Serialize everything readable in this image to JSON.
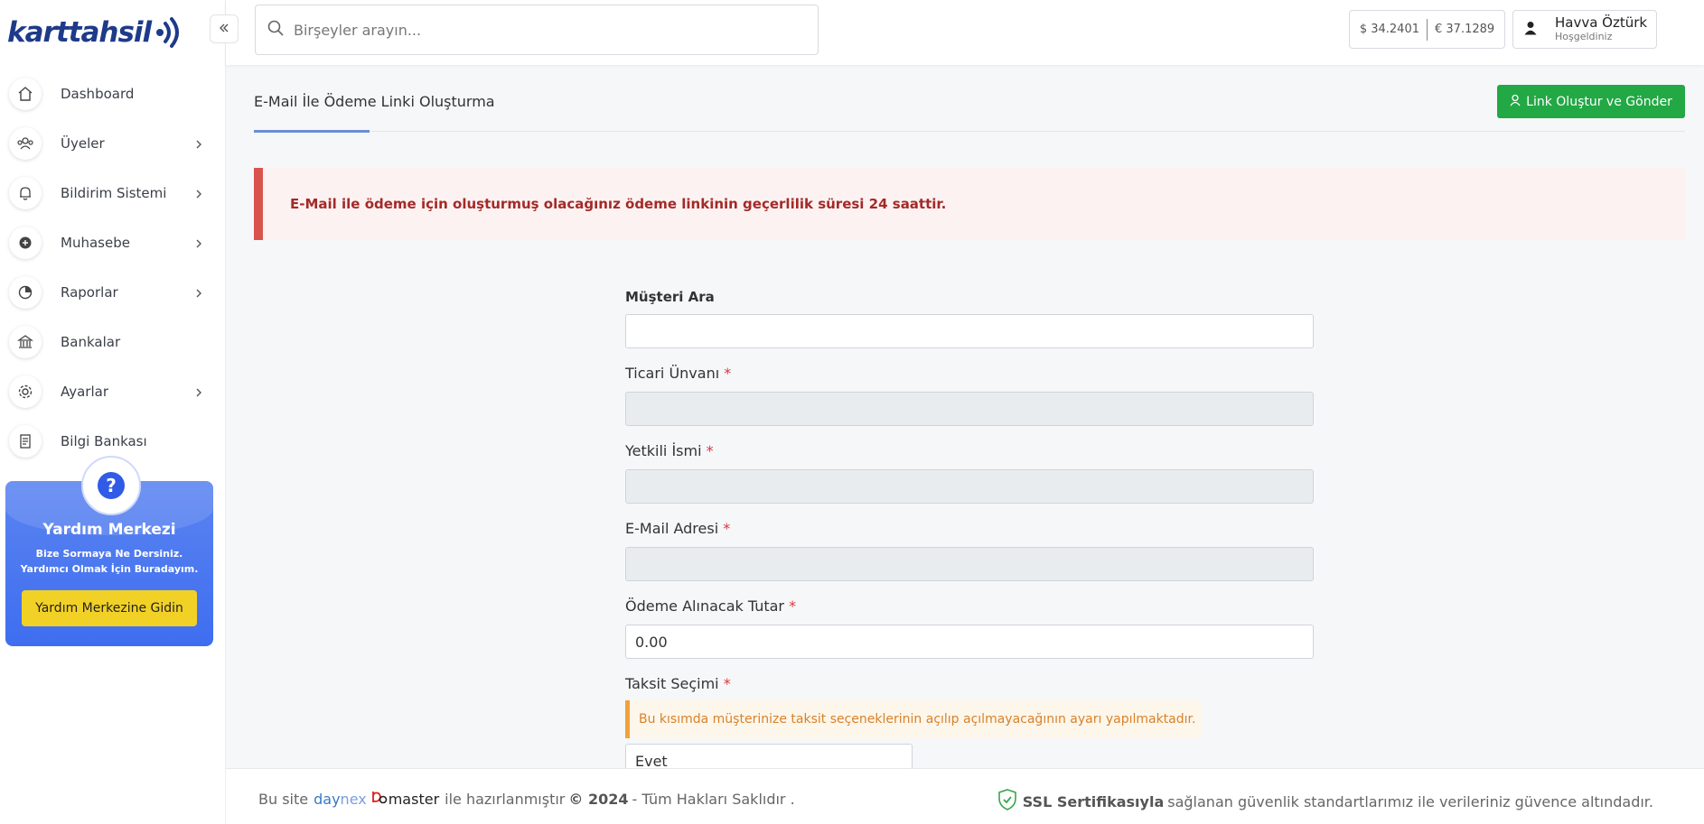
{
  "sidebar": {
    "logo_text": "karttahsil",
    "items": [
      {
        "label": "Dashboard",
        "icon": "home-icon",
        "has_children": false
      },
      {
        "label": "Üyeler",
        "icon": "users-icon",
        "has_children": true
      },
      {
        "label": "Bildirim Sistemi",
        "icon": "bell-icon",
        "has_children": true
      },
      {
        "label": "Muhasebe",
        "icon": "accounting-icon",
        "has_children": true
      },
      {
        "label": "Raporlar",
        "icon": "reports-icon",
        "has_children": true
      },
      {
        "label": "Bankalar",
        "icon": "bank-icon",
        "has_children": false
      },
      {
        "label": "Ayarlar",
        "icon": "gear-icon",
        "has_children": true
      },
      {
        "label": "Bilgi Bankası",
        "icon": "document-icon",
        "has_children": false
      }
    ],
    "help": {
      "title": "Yardım Merkezi",
      "text": "Bize Sormaya Ne Dersiniz. Yardımcı Olmak İçin Buradayım.",
      "button": "Yardım Merkezine Gidin"
    }
  },
  "header": {
    "search_placeholder": "Birşeyler arayın...",
    "usd": "$ 34.2401",
    "eur": "€ 37.1289",
    "user_name": "Havva Öztürk",
    "user_sub": "Hoşgeldiniz"
  },
  "main": {
    "title": "E-Mail İle Ödeme Linki Oluşturma",
    "action_button": "Link Oluştur ve Gönder",
    "alert": "E-Mail ile ödeme için oluşturmuş olacağınız ödeme linkinin geçerlilik süresi 24 saattir.",
    "form": {
      "customer_search_label": "Müşteri Ara",
      "customer_search_value": "",
      "trade_name_label": "Ticari Ünvanı",
      "authorized_label": "Yetkili İsmi",
      "email_label": "E-Mail Adresi",
      "amount_label": "Ödeme Alınacak Tutar",
      "amount_value": "0.00",
      "installment_label": "Taksit Seçimi",
      "installment_notice": "Bu kısımda müşterinize taksit seçeneklerinin açılıp açılmayacağının ayarı yapılmaktadır.",
      "installment_value": "Evet",
      "required_mark": "*"
    }
  },
  "footer": {
    "prefix": "Bu site",
    "brand_a": "day",
    "brand_b": "nex",
    "brand_c": "master",
    "middle": "ile hazırlanmıştır",
    "year": "© 2024",
    "rights": "- Tüm Hakları Saklıdır .",
    "ssl_bold": "SSL Sertifikasıyla",
    "ssl_rest": "sağlanan güvenlik standartlarımız ile verileriniz güvence altındadır."
  },
  "colors": {
    "brand": "#1e3a8a",
    "success": "#22a844",
    "danger": "#d9534f",
    "help_bg": "#3e6ef0",
    "help_button": "#f2d126"
  }
}
